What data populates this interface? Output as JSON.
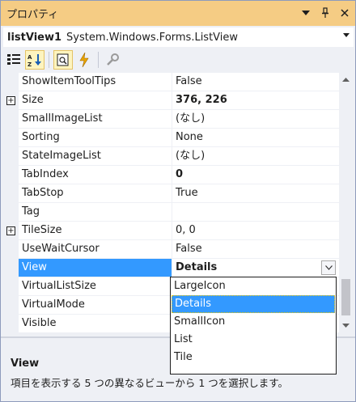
{
  "window": {
    "title": "プロパティ",
    "buttons": [
      {
        "name": "dropdown-arrow-icon",
        "glyph": "▾"
      },
      {
        "name": "pin-icon",
        "glyph": "ᛣ"
      },
      {
        "name": "close-icon",
        "glyph": "✕"
      }
    ]
  },
  "selector": {
    "object_name": "listView1",
    "object_type": "System.Windows.Forms.ListView",
    "dropdown_glyph": "▾"
  },
  "toolbar": {
    "tools": [
      {
        "name": "categorized-icon",
        "active": false
      },
      {
        "name": "alphabetical-icon",
        "active": true
      },
      {
        "name": "properties-icon",
        "active": true
      },
      {
        "name": "events-icon",
        "active": false
      },
      {
        "name": "property-pages-icon",
        "active": false
      }
    ]
  },
  "grid": {
    "rows": [
      {
        "name": "ShowItemToolTips",
        "value": "False",
        "bold": false,
        "expandable": false
      },
      {
        "name": "Size",
        "value": "376, 226",
        "bold": true,
        "expandable": true
      },
      {
        "name": "SmallImageList",
        "value": "(なし)",
        "bold": false,
        "expandable": false
      },
      {
        "name": "Sorting",
        "value": "None",
        "bold": false,
        "expandable": false
      },
      {
        "name": "StateImageList",
        "value": "(なし)",
        "bold": false,
        "expandable": false
      },
      {
        "name": "TabIndex",
        "value": "0",
        "bold": true,
        "expandable": false
      },
      {
        "name": "TabStop",
        "value": "True",
        "bold": false,
        "expandable": false
      },
      {
        "name": "Tag",
        "value": "",
        "bold": false,
        "expandable": false
      },
      {
        "name": "TileSize",
        "value": "0, 0",
        "bold": false,
        "expandable": true
      },
      {
        "name": "UseWaitCursor",
        "value": "False",
        "bold": false,
        "expandable": false
      },
      {
        "name": "View",
        "value": "Details",
        "bold": true,
        "expandable": false,
        "selected": true
      },
      {
        "name": "VirtualListSize",
        "value": "",
        "bold": false,
        "expandable": false
      },
      {
        "name": "VirtualMode",
        "value": "",
        "bold": false,
        "expandable": false
      },
      {
        "name": "Visible",
        "value": "",
        "bold": false,
        "expandable": false
      }
    ],
    "expand_glyph": "+"
  },
  "dropdown": {
    "options": [
      "LargeIcon",
      "Details",
      "SmallIcon",
      "List",
      "Tile"
    ],
    "selected": "Details"
  },
  "description": {
    "title": "View",
    "text": "項目を表示する 5 つの異なるビューから 1 つを選択します。"
  },
  "colors": {
    "titlebar": "#f5cc84",
    "selection": "#3399ff",
    "background": "#eef0f5"
  }
}
